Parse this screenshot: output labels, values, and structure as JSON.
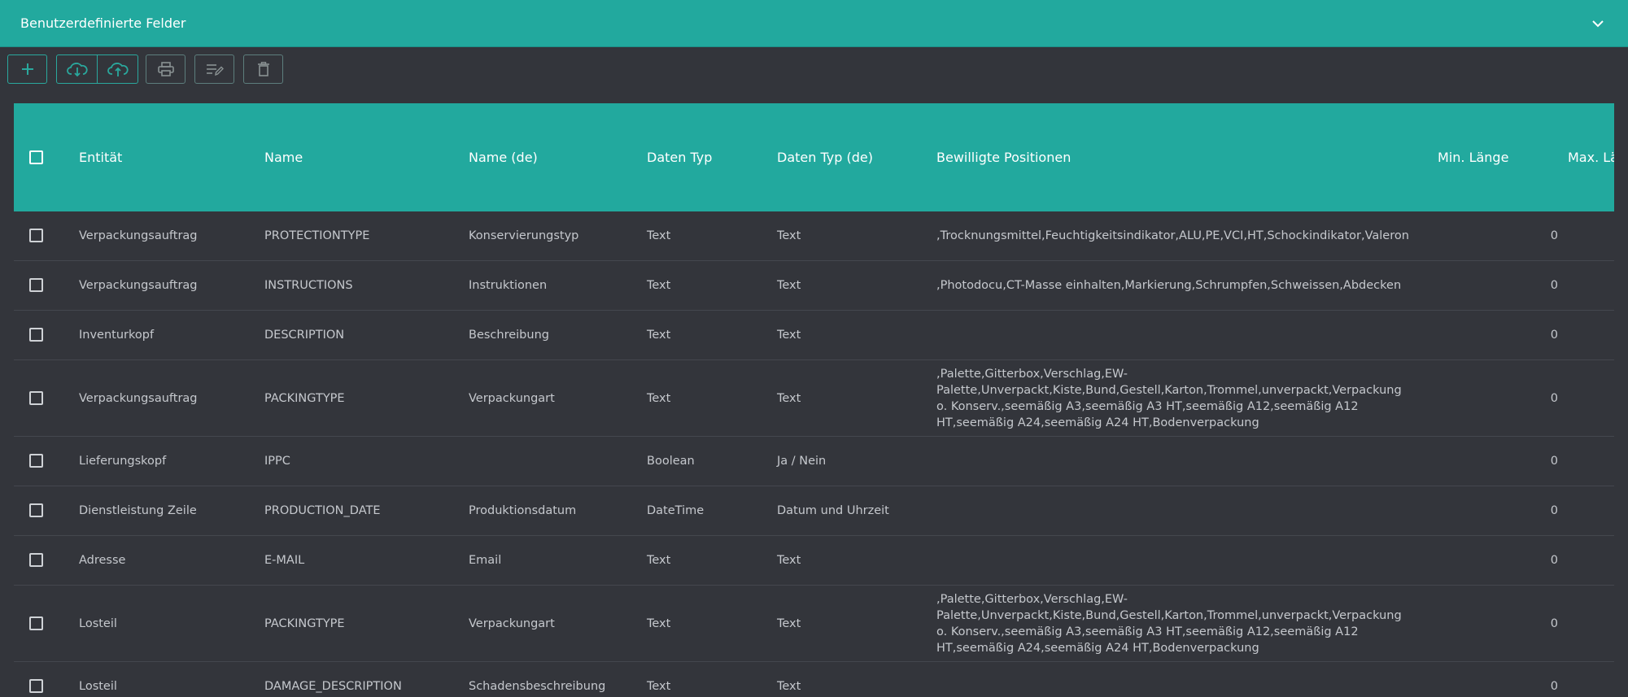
{
  "header": {
    "title": "Benutzerdefinierte Felder"
  },
  "colors": {
    "accent": "#22a99e",
    "background": "#33353b",
    "text": "#c5c8cd"
  },
  "toolbar": {
    "buttons": [
      {
        "name": "add-button",
        "icon": "plus-icon"
      },
      {
        "name": "download-button",
        "icon": "cloud-download-icon"
      },
      {
        "name": "upload-button",
        "icon": "cloud-upload-icon"
      },
      {
        "name": "print-button",
        "icon": "printer-icon"
      },
      {
        "name": "edit-button",
        "icon": "edit-list-icon"
      },
      {
        "name": "delete-button",
        "icon": "trash-icon"
      }
    ]
  },
  "table": {
    "columns": [
      "Entität",
      "Name",
      "Name (de)",
      "Daten Typ",
      "Daten Typ (de)",
      "Bewilligte Positionen",
      "Min. Länge",
      "Max. Länge"
    ],
    "rows": [
      {
        "entity": "Verpackungsauftrag",
        "name": "PROTECTIONTYPE",
        "name_de": "Konservierungstyp",
        "type": "Text",
        "type_de": "Text",
        "positions": ",Trocknungsmittel,Feuchtigkeitsindikator,ALU,PE,VCI,HT,Schockindikator,Valeron",
        "min": "0"
      },
      {
        "entity": "Verpackungsauftrag",
        "name": "INSTRUCTIONS",
        "name_de": "Instruktionen",
        "type": "Text",
        "type_de": "Text",
        "positions": ",Photodocu,CT-Masse einhalten,Markierung,Schrumpfen,Schweissen,Abdecken",
        "min": "0"
      },
      {
        "entity": "Inventurkopf",
        "name": "DESCRIPTION",
        "name_de": "Beschreibung",
        "type": "Text",
        "type_de": "Text",
        "positions": "",
        "min": "0"
      },
      {
        "entity": "Verpackungsauftrag",
        "name": "PACKINGTYPE",
        "name_de": "Verpackungart",
        "type": "Text",
        "type_de": "Text",
        "positions": ",Palette,Gitterbox,Verschlag,EW-Palette,Unverpackt,Kiste,Bund,Gestell,Karton,Trommel,unverpackt,Verpackung o. Konserv.,seemäßig A3,seemäßig A3 HT,seemäßig A12,seemäßig A12 HT,seemäßig A24,seemäßig A24 HT,Bodenverpackung",
        "min": "0"
      },
      {
        "entity": "Lieferungskopf",
        "name": "IPPC",
        "name_de": "",
        "type": "Boolean",
        "type_de": "Ja / Nein",
        "positions": "",
        "min": "0"
      },
      {
        "entity": "Dienstleistung Zeile",
        "name": "PRODUCTION_DATE",
        "name_de": "Produktionsdatum",
        "type": "DateTime",
        "type_de": "Datum und Uhrzeit",
        "positions": "",
        "min": "0"
      },
      {
        "entity": "Adresse",
        "name": "E-MAIL",
        "name_de": "Email",
        "type": "Text",
        "type_de": "Text",
        "positions": "",
        "min": "0"
      },
      {
        "entity": "Losteil",
        "name": "PACKINGTYPE",
        "name_de": "Verpackungart",
        "type": "Text",
        "type_de": "Text",
        "positions": ",Palette,Gitterbox,Verschlag,EW-Palette,Unverpackt,Kiste,Bund,Gestell,Karton,Trommel,unverpackt,Verpackung o. Konserv.,seemäßig A3,seemäßig A3 HT,seemäßig A12,seemäßig A12 HT,seemäßig A24,seemäßig A24 HT,Bodenverpackung",
        "min": "0"
      },
      {
        "entity": "Losteil",
        "name": "DAMAGE_DESCRIPTION",
        "name_de": "Schadensbeschreibung",
        "type": "Text",
        "type_de": "Text",
        "positions": "",
        "min": "0"
      }
    ]
  }
}
